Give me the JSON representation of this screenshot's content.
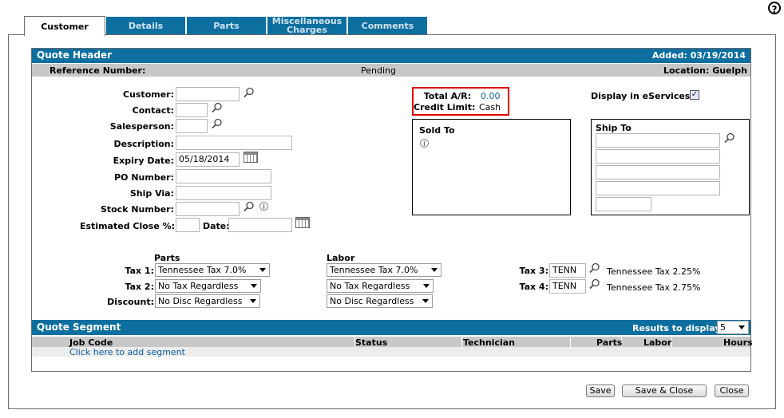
{
  "tabs": [
    "Customer",
    "Details",
    "Parts",
    "Miscellaneous Charges",
    "Comments"
  ],
  "header": {
    "title": "Quote Header",
    "added": "Added: 03/19/2014",
    "ref_label": "Reference Number:",
    "status": "Pending",
    "location": "Location: Guelph"
  },
  "form": {
    "customer": "Customer:",
    "contact": "Contact:",
    "salesperson": "Salesperson:",
    "description": "Description:",
    "expiry_label": "Expiry Date:",
    "expiry_value": "05/18/2014",
    "po": "PO Number:",
    "ship_via": "Ship Via:",
    "stock": "Stock Number:",
    "est_close": "Estimated Close %:",
    "date": "Date:"
  },
  "ar": {
    "total_label": "Total A/R:",
    "total_value": "0.00",
    "credit_label": "Credit Limit:",
    "credit_value": "Cash"
  },
  "eservices": {
    "label": "Display in eServices:",
    "checked": true
  },
  "sold_to": "Sold To",
  "ship_to": "Ship To",
  "tax": {
    "parts_heading": "Parts",
    "labor_heading": "Labor",
    "tax1_label": "Tax 1:",
    "tax2_label": "Tax 2:",
    "discount_label": "Discount:",
    "parts_tax1": "Tennessee Tax 7.0%",
    "parts_tax2": "No Tax Regardless",
    "parts_discount": "No Disc Regardless",
    "labor_tax1": "Tennessee Tax 7.0%",
    "labor_tax2": "No Tax Regardless",
    "labor_discount": "No Disc Regardless",
    "tax3_label": "Tax 3:",
    "tax3_code": "TENN",
    "tax3_desc": "Tennessee Tax 2.25%",
    "tax4_label": "Tax 4:",
    "tax4_code": "TENN",
    "tax4_desc": "Tennessee Tax 2.75%"
  },
  "segment": {
    "title": "Quote Segment",
    "results_label": "Results to display:",
    "results_value": "5",
    "columns": [
      "Job Code",
      "Status",
      "Technician",
      "Parts",
      "Labor",
      "Hours"
    ],
    "add_link": "Click here to add segment"
  },
  "buttons": {
    "save": "Save",
    "save_close": "Save & Close",
    "close": "Close"
  },
  "colors": {
    "accent": "#0d6ea0",
    "bar_gray": "#c8c8c8",
    "highlight_red": "#e00000"
  }
}
